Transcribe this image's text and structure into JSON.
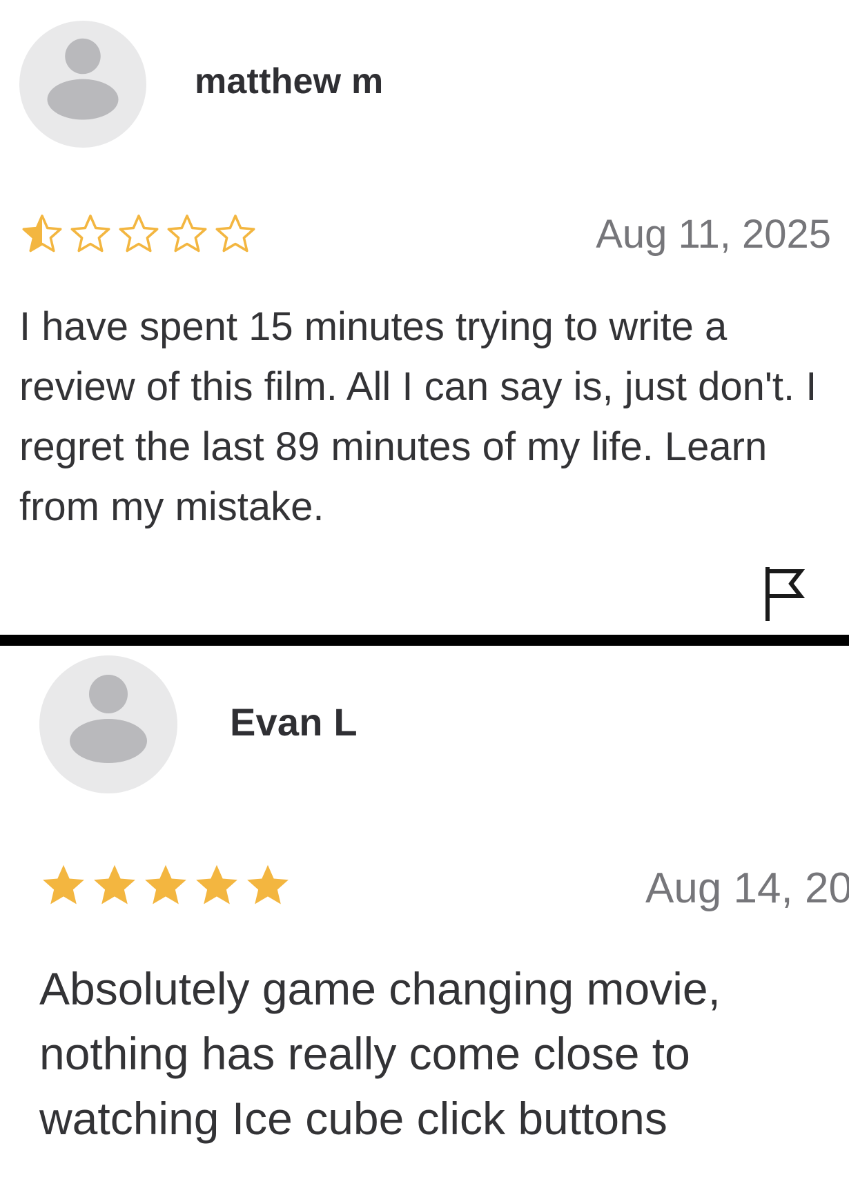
{
  "colors": {
    "star": "#f3b640",
    "avatar_bg": "#e9e9ea",
    "avatar_fg": "#b9b9bc",
    "name": "#2f2f33",
    "date": "#76767a",
    "text": "#333336",
    "divider": "#000000"
  },
  "reviews": [
    {
      "reviewer": "matthew m",
      "avatar_icon": "person-icon",
      "rating": 0.5,
      "max_rating": 5,
      "date": "Aug 11, 2025",
      "text": "I have spent 15 minutes trying to write a review of this film. All I can say is, just don't. I regret the last 89 minutes of my life. Learn from my mistake.",
      "flag_icon": "flag-icon"
    },
    {
      "reviewer": "Evan L",
      "avatar_icon": "person-icon",
      "rating": 5,
      "max_rating": 5,
      "date": "Aug 14, 20",
      "text": "Absolutely game changing movie, nothing has really come close to watching Ice cube click buttons"
    }
  ]
}
